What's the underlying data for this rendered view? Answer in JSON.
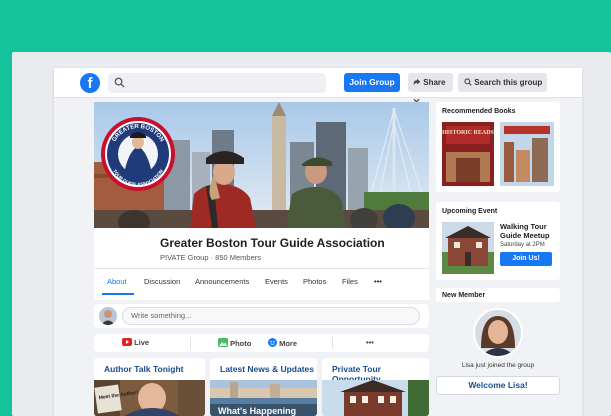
{
  "topbar": {
    "logo_letter": "f",
    "search_placeholder": "",
    "join_label": "Join Group",
    "share_label": "Share",
    "search_group_label": "Search this group"
  },
  "cover": {
    "badge_top": "GREATER BOSTON",
    "badge_bottom": "TOUR GUIDE ASSOCIATION"
  },
  "group": {
    "title": "Greater Boston Tour Guide Association",
    "subtitle": "PIVATE Group · 850 Members",
    "tabs": [
      "About",
      "Discussion",
      "Announcements",
      "Events",
      "Photos",
      "Files",
      "•••"
    ]
  },
  "composer": {
    "placeholder": "Write something..."
  },
  "actions": {
    "live": "Live",
    "photo": "Photo",
    "more": "More",
    "overflow": "•••"
  },
  "cards": [
    {
      "title": "Author Talk Tonight",
      "overlay": "Meet the Author!"
    },
    {
      "title": "Latest News & Updates",
      "overlay": "What's Happening"
    },
    {
      "title": "Private Tour Opportunity",
      "overlay": ""
    }
  ],
  "sidebar": {
    "books_title": "Recommended Books",
    "book1_title": "HISTORIC READS",
    "event_title_label": "Upcoming Event",
    "event_name": "Walking Tour Guide Meetup",
    "event_time": "Saturday at 2PM",
    "event_button": "Join Us!",
    "member_title": "New Member",
    "member_text": "Lisa just joined the group",
    "welcome_button": "Welcome Lisa!"
  },
  "colors": {
    "background_teal": "#13c39b",
    "brand_blue": "#1877f2",
    "title_navy": "#1a4c8c"
  }
}
